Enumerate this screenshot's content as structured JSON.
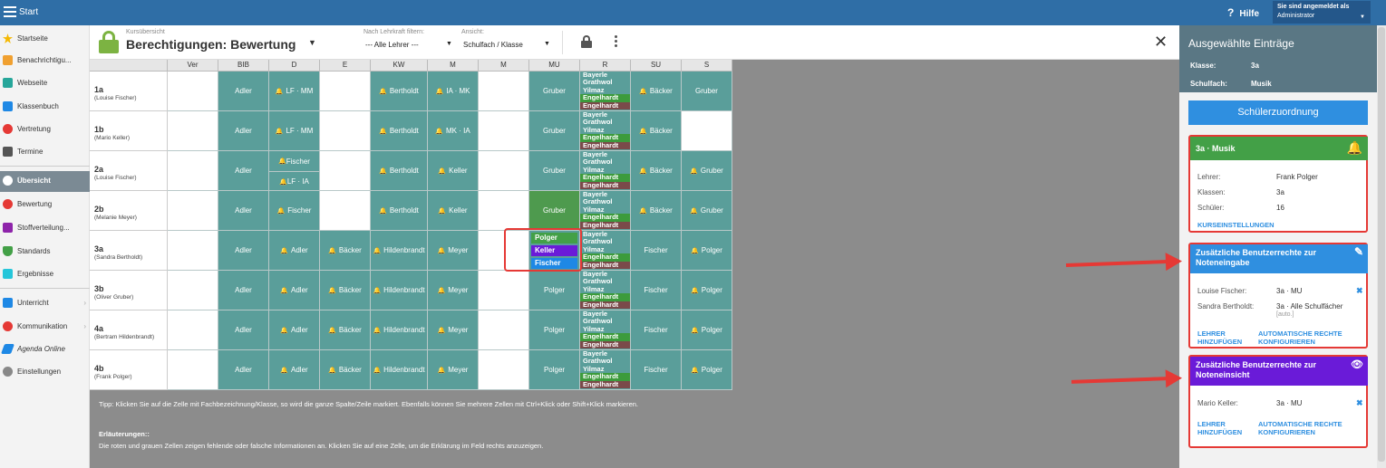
{
  "topbar": {
    "start": "Start",
    "help": "Hilfe",
    "user_line1": "Sie sind angemeldet als",
    "user_line2": "Administrator"
  },
  "sidebar": {
    "items": [
      "Startseite",
      "Benachrichtigu...",
      "Webseite",
      "Klassenbuch",
      "Vertretung",
      "Termine",
      "Übersicht",
      "Bewertung",
      "Stoffverteilung...",
      "Standards",
      "Ergebnisse",
      "Unterricht",
      "Kommunikation",
      "Agenda Online",
      "Einstellungen"
    ]
  },
  "header": {
    "subtitle": "Kursübersicht",
    "title": "Berechtigungen: Bewertung",
    "filter_label": "Nach Lehrkraft filtern:",
    "filter_value": "--- Alle Lehrer ---",
    "view_label": "Ansicht:",
    "view_value": "Schulfach / Klasse"
  },
  "grid": {
    "columns": [
      "Ver",
      "BIB",
      "D",
      "E",
      "KW",
      "M",
      "M",
      "MU",
      "R",
      "SU",
      "S"
    ],
    "rows": [
      {
        "cls": "1a",
        "teacher": "(Louise Fischer)"
      },
      {
        "cls": "1b",
        "teacher": "(Mario Keller)"
      },
      {
        "cls": "2a",
        "teacher": "(Louise Fischer)"
      },
      {
        "cls": "2b",
        "teacher": "(Melanie Meyer)"
      },
      {
        "cls": "3a",
        "teacher": "(Sandra Bertholdt)"
      },
      {
        "cls": "3b",
        "teacher": "(Oliver Gruber)"
      },
      {
        "cls": "4a",
        "teacher": "(Bertram Hildenbrandt)"
      },
      {
        "cls": "4b",
        "teacher": "(Frank Polger)"
      }
    ],
    "names": {
      "adler": "Adler",
      "lfmm": "LF · MM",
      "lfia": "LF · IA",
      "fischer": "Fischer",
      "bertholdt": "Bertholdt",
      "iamk": "IA · MK",
      "mkia": "MK · IA",
      "keller": "Keller",
      "gruber": "Gruber",
      "baecker": "Bäcker",
      "hildenbrandt": "Hildenbrandt",
      "meyer": "Meyer",
      "polger": "Polger"
    },
    "r_list": [
      "Bayerle",
      "Grathwol",
      "Yilmaz",
      "Engelhardt",
      "Engelhardt"
    ],
    "mu_3a": [
      "Polger",
      "Keller",
      "Fischer"
    ]
  },
  "tips": {
    "line1": "Tipp: Klicken Sie auf die Zelle mit Fachbezeichnung/Klasse, so wird die ganze Spalte/Zeile markiert. Ebenfalls können Sie mehrere Zellen mit Ctrl+Klick oder Shift+Klick markieren.",
    "line2": "Erläuterungen::",
    "line3": "Die roten und grauen Zellen zeigen fehlende oder falsche Informationen an. Klicken Sie auf eine Zelle, um die Erklärung im Feld rechts anzuzeigen."
  },
  "panel": {
    "title": "Ausgewählte Einträge",
    "klasse_label": "Klasse:",
    "klasse_value": "3a",
    "fach_label": "Schulfach:",
    "fach_value": "Musik",
    "button": "Schülerzuordnung",
    "card1": {
      "title": "3a · Musik",
      "lehrer_label": "Lehrer:",
      "lehrer_value": "Frank Polger",
      "klassen_label": "Klassen:",
      "klassen_value": "3a",
      "schueler_label": "Schüler:",
      "schueler_value": "16",
      "link": "KURSEINSTELLUNGEN"
    },
    "card2": {
      "title": "Zusätzliche Benutzerrechte zur Noteneingabe",
      "r1_name": "Louise Fischer:",
      "r1_value": "3a · MU",
      "r2_name": "Sandra Bertholdt:",
      "r2_value": "3a · Alle Schulfächer",
      "r2_note": "[auto.]",
      "link1a": "LEHRER",
      "link1b": "HINZUFÜGEN",
      "link2a": "AUTOMATISCHE RECHTE",
      "link2b": "KONFIGURIEREN"
    },
    "card3": {
      "title": "Zusätzliche Benutzerrechte zur Noteneinsicht",
      "r1_name": "Mario Keller:",
      "r1_value": "3a · MU",
      "link1a": "LEHRER",
      "link1b": "HINZUFÜGEN",
      "link2a": "AUTOMATISCHE RECHTE",
      "link2b": "KONFIGURIEREN"
    }
  },
  "colors": {
    "teal": "#5a9e9a",
    "green": "#43a047",
    "blue": "#1e88e5",
    "purple": "#6a1bd8",
    "red": "#e53935"
  }
}
